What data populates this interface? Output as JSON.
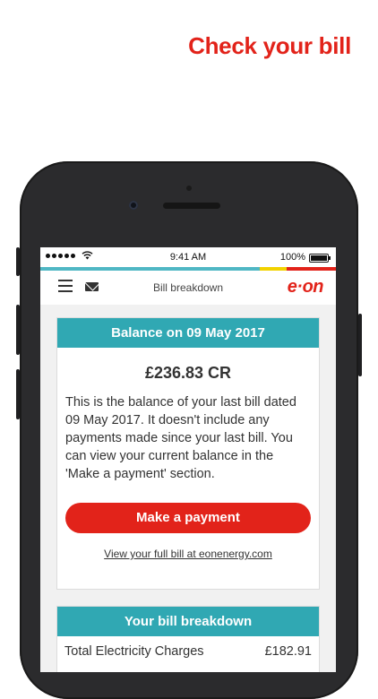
{
  "headline": "Check your bill",
  "status_bar": {
    "time": "9:41 AM",
    "battery": "100%"
  },
  "header": {
    "title": "Bill breakdown",
    "logo": "e·on",
    "icons": [
      "menu-icon",
      "mail-icon"
    ]
  },
  "balance_card": {
    "title": "Balance on 09 May 2017",
    "amount": "£236.83 CR",
    "description": "This is the balance of your last bill dated 09 May 2017. It doesn't include any payments made since your last bill. You can view your current balance in the 'Make a payment' section.",
    "button_label": "Make a payment",
    "link_text": "View your full bill at eonenergy.com"
  },
  "breakdown_card": {
    "title": "Your bill breakdown",
    "rows": [
      {
        "label": "Total Electricity Charges",
        "value": "£182.91"
      }
    ]
  },
  "colors": {
    "brand_red": "#e2231a",
    "teal": "#30a8b3",
    "yellow": "#f2d200"
  }
}
